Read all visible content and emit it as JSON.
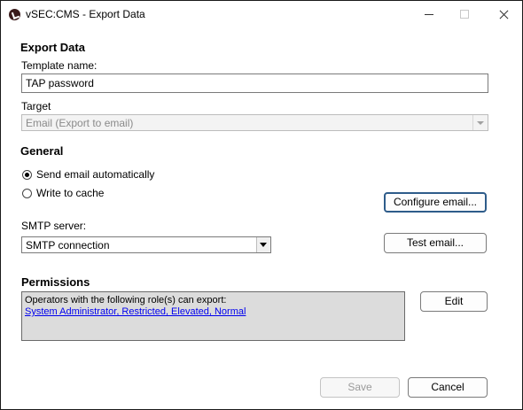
{
  "window": {
    "title": "vSEC:CMS - Export Data",
    "icon": "app-logo-icon"
  },
  "export_data": {
    "heading": "Export Data",
    "template_name_label": "Template name:",
    "template_name_value": "TAP password",
    "target_label": "Target",
    "target_value": "Email (Export to email)"
  },
  "general": {
    "heading": "General",
    "send_email_label": "Send email automatically",
    "send_email_checked": true,
    "write_cache_label": "Write to cache",
    "write_cache_checked": false,
    "configure_email_button": "Configure email...",
    "smtp_label": "SMTP server:",
    "smtp_value": "SMTP connection",
    "test_email_button": "Test email..."
  },
  "permissions": {
    "heading": "Permissions",
    "description": "Operators with the following role(s) can export:",
    "roles_link": "System Administrator, Restricted, Elevated, Normal",
    "edit_button": "Edit"
  },
  "footer": {
    "save_button": "Save",
    "cancel_button": "Cancel"
  },
  "colors": {
    "accent_border": "#2e5c8a",
    "link": "#0000ee",
    "permissions_bg": "#dcdcdc"
  }
}
